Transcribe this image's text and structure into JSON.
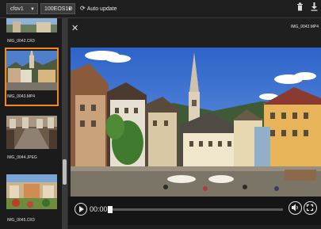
{
  "toolbar": {
    "folder_select": "cfov1",
    "card_select": "100EOS1D",
    "auto_update_label": "Auto update",
    "icons": [
      "sync-icon",
      "trash-icon",
      "download-icon"
    ]
  },
  "thumbnails": [
    {
      "label": "IMG_0042.CR3",
      "selected": false
    },
    {
      "label": "IMG_0043.MP4",
      "selected": true
    },
    {
      "label": "IMG_0044.JPEG",
      "selected": false
    },
    {
      "label": "IMG_0045.CR3",
      "selected": false
    }
  ],
  "viewer": {
    "file_name": "IMG_0043.MP4",
    "time": "00:00",
    "progress": 0
  },
  "colors": {
    "accent": "#f08a1c",
    "background": "#2b2b2b"
  }
}
